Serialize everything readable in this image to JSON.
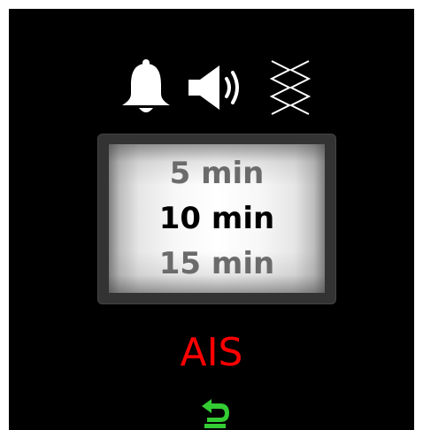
{
  "alert_modes": {
    "icons": [
      "bell-icon",
      "speaker-icon",
      "vibrate-icon"
    ]
  },
  "interval_picker": {
    "previous_option": "5 min",
    "selected_option": "10 min",
    "next_option": "15 min"
  },
  "mode_label": "AIS",
  "back": {
    "icon": "back-arrow-icon",
    "color": "#33cc33"
  },
  "colors": {
    "background": "#000000",
    "mode_label": "#ff0000",
    "selected_text": "#000000",
    "dim_text": "#6b6b6b"
  }
}
